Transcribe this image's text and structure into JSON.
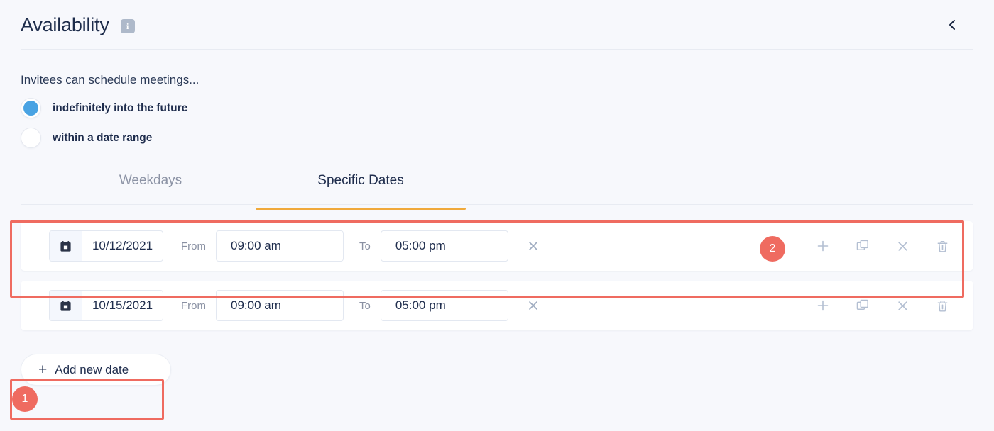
{
  "header": {
    "title": "Availability",
    "info_icon": "info-icon",
    "info_glyph": "i",
    "collapse_icon": "chevron-left-icon"
  },
  "body": {
    "prompt": "Invitees can schedule meetings...",
    "radios": [
      {
        "label": "indefinitely into the future",
        "checked": true
      },
      {
        "label": "within a date range",
        "checked": false
      }
    ]
  },
  "tabs": [
    {
      "label": "Weekdays",
      "active": false
    },
    {
      "label": "Specific Dates",
      "active": true
    }
  ],
  "rows": [
    {
      "calendar_icon": "calendar-icon",
      "date": "10/12/2021",
      "from_label": "From",
      "from_time": "09:00 am",
      "to_label": "To",
      "to_time": "05:00 pm",
      "clear_icon": "close-icon",
      "actions": [
        "plus-icon",
        "copy-icon",
        "close-icon",
        "trash-icon"
      ]
    },
    {
      "calendar_icon": "calendar-icon",
      "date": "10/15/2021",
      "from_label": "From",
      "from_time": "09:00 am",
      "to_label": "To",
      "to_time": "05:00 pm",
      "clear_icon": "close-icon",
      "actions": [
        "plus-icon",
        "copy-icon",
        "close-icon",
        "trash-icon"
      ]
    }
  ],
  "add_button": {
    "plus": "+",
    "label": "Add new date"
  },
  "annotations": [
    {
      "badge": "1",
      "target": "add-new-date-button"
    },
    {
      "badge": "2",
      "target": "specific-date-row-1"
    }
  ],
  "colors": {
    "page_background": "#f7f8fc",
    "card": "#ffffff",
    "text": "#1f2d4d",
    "muted_text": "#8a91a3",
    "accent_tab_underline": "#f0a93b",
    "radio_selected": "#49a3e3",
    "annotation": "#ef6b60",
    "icon": "#b3bfd2"
  }
}
